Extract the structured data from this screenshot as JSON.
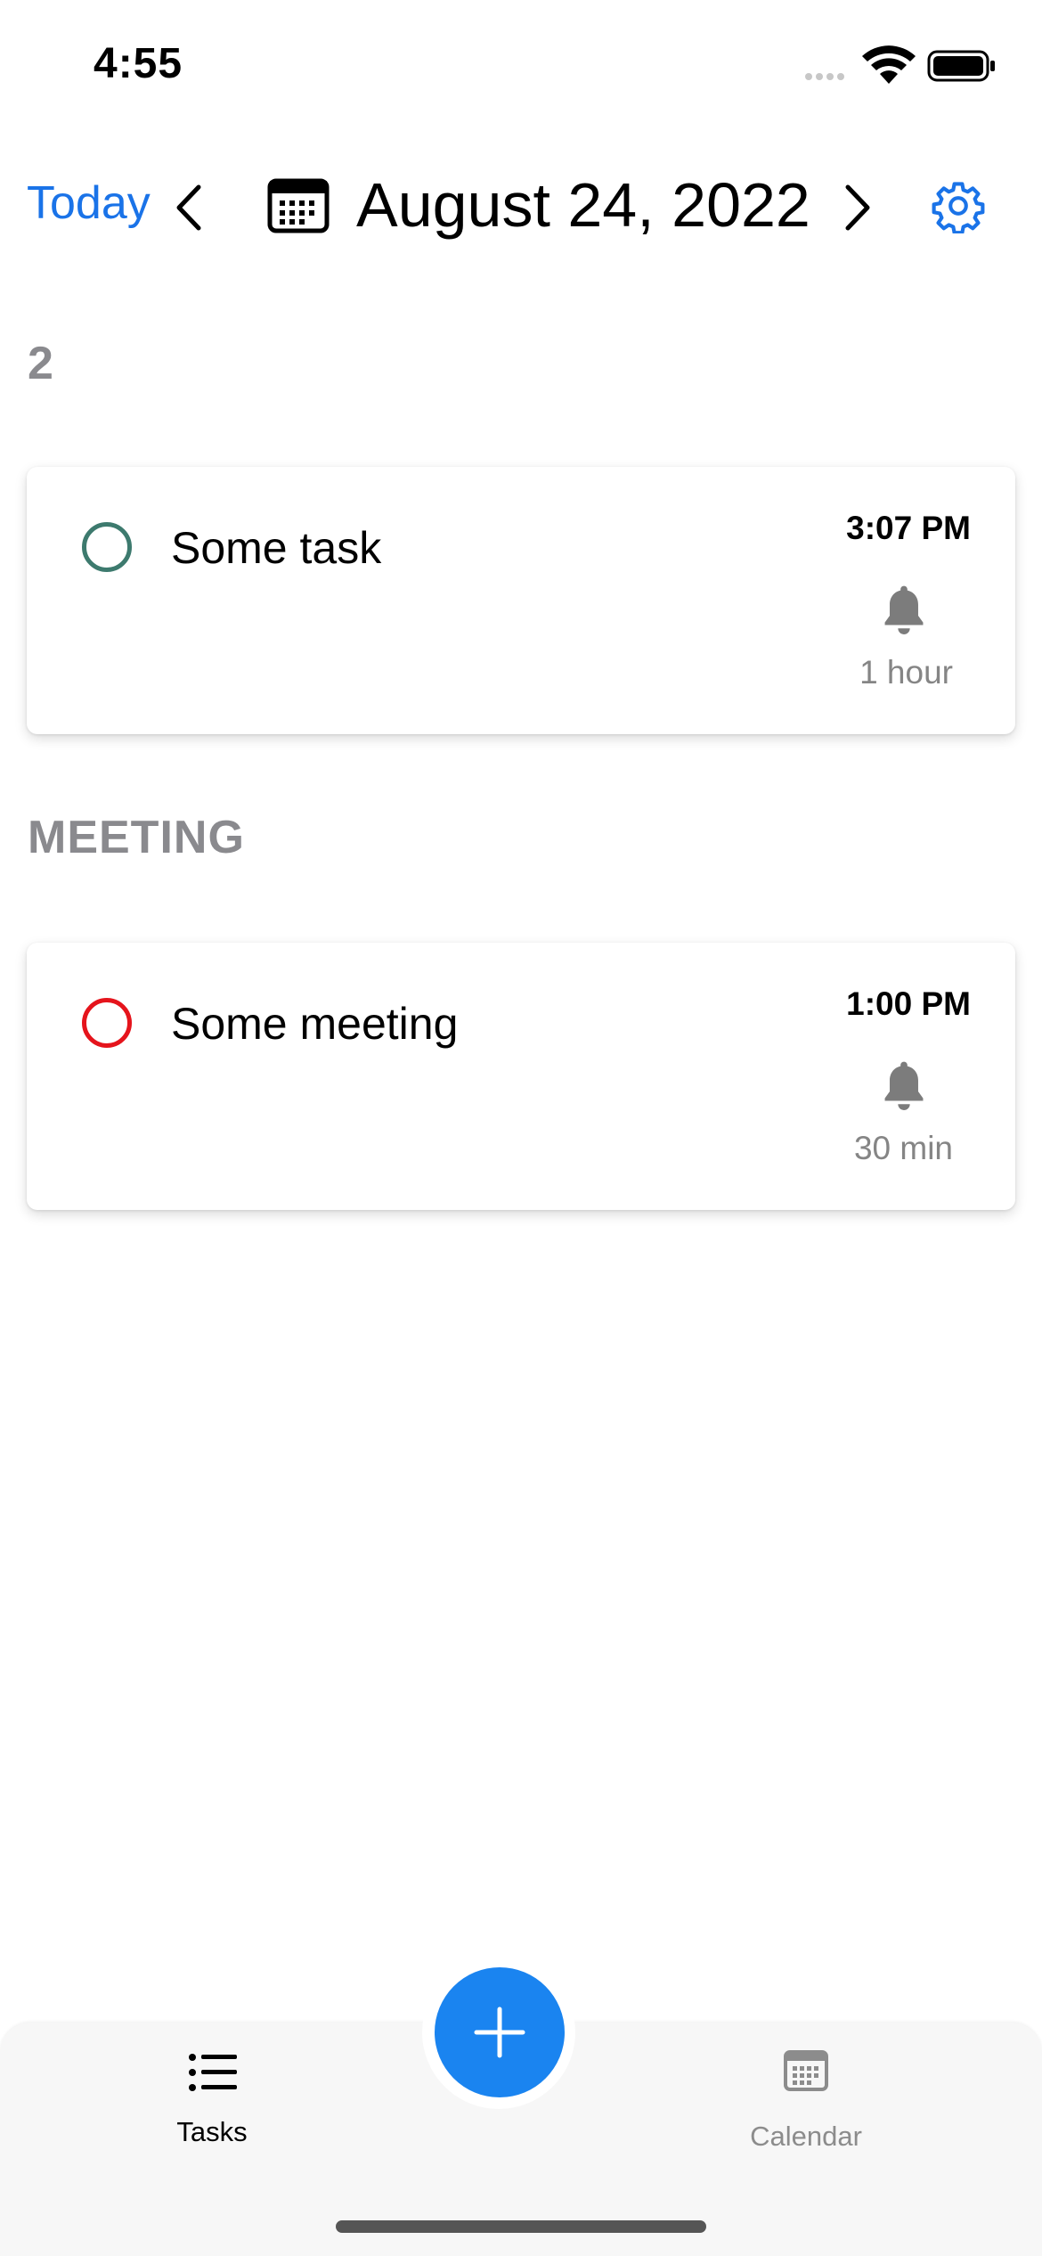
{
  "status_bar": {
    "time": "4:55"
  },
  "header": {
    "today_label": "Today",
    "date_title": "August 24, 2022"
  },
  "sections": [
    {
      "header": "2",
      "items": [
        {
          "title": "Some task",
          "time": "3:07 PM",
          "reminder": "1 hour",
          "status_color": "#3d7a6e"
        }
      ]
    },
    {
      "header": "MEETING",
      "items": [
        {
          "title": "Some meeting",
          "time": "1:00 PM",
          "reminder": "30 min",
          "status_color": "#e5141c"
        }
      ]
    }
  ],
  "tab_bar": {
    "tasks_label": "Tasks",
    "calendar_label": "Calendar",
    "active_tab": "Tasks"
  },
  "colors": {
    "accent": "#1a73e8",
    "fab": "#1a84f0",
    "section_header": "#8a8a8e",
    "muted": "#858585",
    "inactive_tab": "#8c8c8c"
  },
  "icons": [
    "calendar-icon",
    "chevron-left-icon",
    "chevron-right-icon",
    "gear-icon",
    "bell-icon",
    "plus-icon",
    "list-icon",
    "wifi-icon",
    "battery-icon",
    "cellular-icon"
  ]
}
